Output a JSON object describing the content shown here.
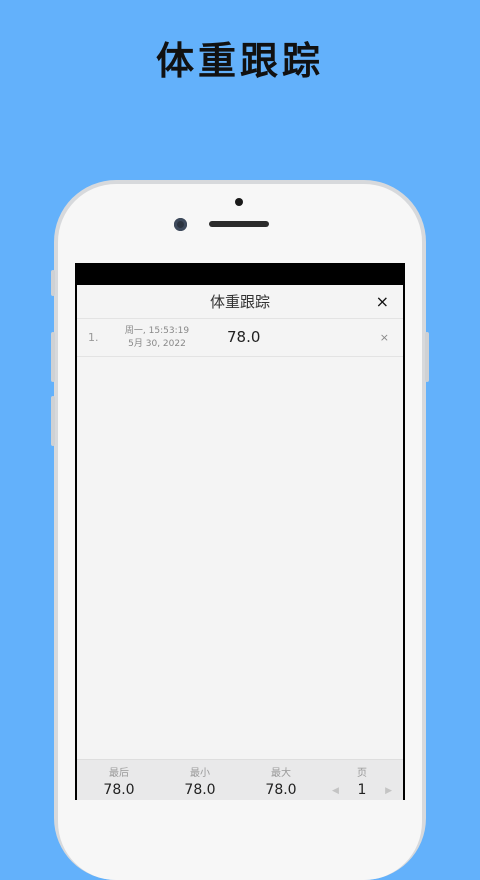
{
  "banner": {
    "title": "体重跟踪"
  },
  "app": {
    "title": "体重跟踪",
    "close_label": "×"
  },
  "entries": [
    {
      "index": "1.",
      "date_line1": "周一, 15:53:19",
      "date_line2": "5月 30, 2022",
      "value": "78.0",
      "delete_label": "×"
    }
  ],
  "stats": {
    "last": {
      "label": "最后",
      "value": "78.0"
    },
    "min": {
      "label": "最小",
      "value": "78.0"
    },
    "max": {
      "label": "最大",
      "value": "78.0"
    },
    "page": {
      "label": "页",
      "value": "1"
    }
  },
  "colors": {
    "background": "#63b1fb",
    "app_background": "#f4f4f4"
  },
  "icons": {
    "prev": "triangle-left",
    "next": "triangle-right",
    "close": "close-x"
  }
}
